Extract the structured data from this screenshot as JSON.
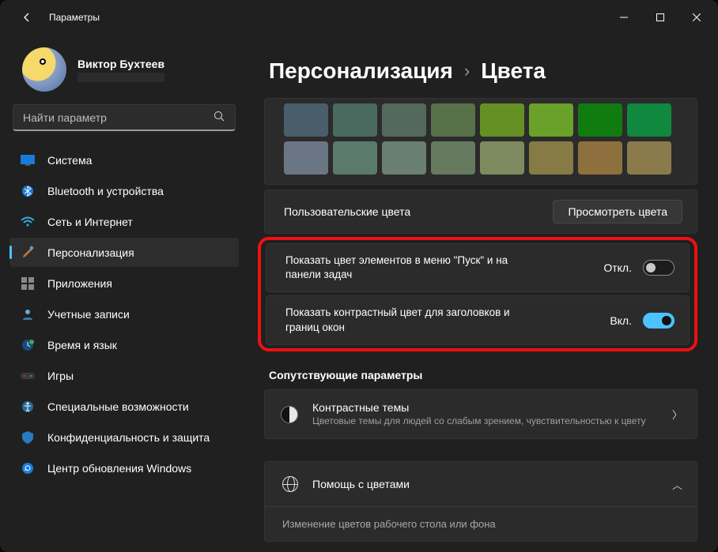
{
  "titlebar": {
    "title": "Параметры"
  },
  "user": {
    "name": "Виктор Бухтеев"
  },
  "search": {
    "placeholder": "Найти параметр"
  },
  "nav": [
    {
      "id": "system",
      "label": "Система"
    },
    {
      "id": "bluetooth",
      "label": "Bluetooth и устройства"
    },
    {
      "id": "network",
      "label": "Сеть и Интернет"
    },
    {
      "id": "personalization",
      "label": "Персонализация"
    },
    {
      "id": "apps",
      "label": "Приложения"
    },
    {
      "id": "accounts",
      "label": "Учетные записи"
    },
    {
      "id": "time",
      "label": "Время и язык"
    },
    {
      "id": "gaming",
      "label": "Игры"
    },
    {
      "id": "accessibility",
      "label": "Специальные возможности"
    },
    {
      "id": "privacy",
      "label": "Конфиденциальность и защита"
    },
    {
      "id": "update",
      "label": "Центр обновления Windows"
    }
  ],
  "breadcrumb": {
    "parent": "Персонализация",
    "current": "Цвета"
  },
  "swatches": [
    [
      "#4a5d6b",
      "#4a6a60",
      "#53695e",
      "#597148",
      "#649024",
      "#6aa12a",
      "#107c10",
      "#10893e"
    ],
    [
      "#6b7685",
      "#5a7a6b",
      "#6a7f6f",
      "#657a5e",
      "#7d8b5e",
      "#867a45",
      "#8e6f3e",
      "#8a7a4c"
    ]
  ],
  "custom": {
    "label": "Пользовательские цвета",
    "button": "Просмотреть цвета"
  },
  "highlights": {
    "start": {
      "label": "Показать цвет элементов в меню \"Пуск\" и на панели задач",
      "state": "Откл."
    },
    "title": {
      "label": "Показать контрастный цвет для заголовков и границ окон",
      "state": "Вкл."
    }
  },
  "related": {
    "header": "Сопутствующие параметры",
    "card": {
      "title": "Контрастные темы",
      "sub": "Цветовые темы для людей со слабым зрением, чувствительностью к цвету"
    }
  },
  "help": {
    "title": "Помощь с цветами",
    "item": "Изменение цветов рабочего стола или фона"
  }
}
